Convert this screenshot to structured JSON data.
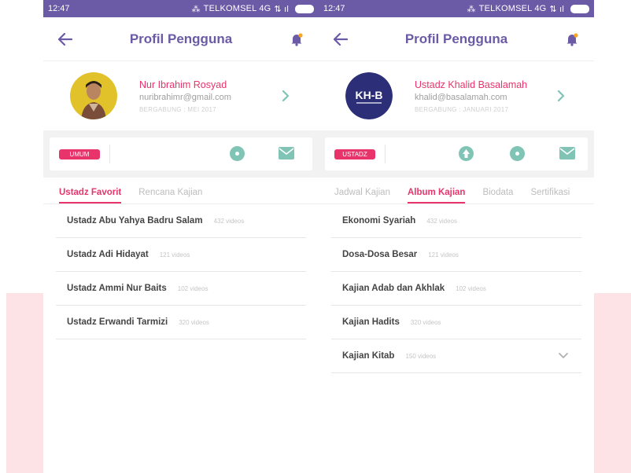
{
  "colors": {
    "primary": "#6b5aa6",
    "accent": "#e8346a",
    "teal": "#7fc4b5",
    "pink_bg": "#fde3e6"
  },
  "left": {
    "status": {
      "time": "12:47",
      "carrier": "TELKOMSEL 4G"
    },
    "header": {
      "title": "Profil Pengguna"
    },
    "profile": {
      "name": "Nur Ibrahim Rosyad",
      "email": "nuribrahimr@gmail.com",
      "joined": "BERGABUNG : MEI 2017"
    },
    "badge": "UMUM",
    "tabs": [
      {
        "label": "Ustadz Favorit",
        "active": true
      },
      {
        "label": "Rencana Kajian",
        "active": false
      }
    ],
    "items": [
      {
        "name": "Ustadz Abu Yahya Badru Salam",
        "count": "432 videos"
      },
      {
        "name": "Ustadz Adi Hidayat",
        "count": "121 videos"
      },
      {
        "name": "Ustadz Ammi Nur Baits",
        "count": "102 videos"
      },
      {
        "name": "Ustadz Erwandi Tarmizi",
        "count": "320 videos"
      }
    ]
  },
  "right": {
    "status": {
      "time": "12:47",
      "carrier": "TELKOMSEL 4G"
    },
    "header": {
      "title": "Profil Pengguna"
    },
    "profile": {
      "name": "Ustadz Khalid Basalamah",
      "email": "khalid@basalamah.com",
      "joined": "BERGABUNG : JANUARI 2017",
      "logo_text": "KH-B"
    },
    "badge": "USTADZ",
    "tabs": [
      {
        "label": "Jadwal Kajian",
        "active": false
      },
      {
        "label": "Album Kajian",
        "active": true
      },
      {
        "label": "Biodata",
        "active": false
      },
      {
        "label": "Sertifikasi",
        "active": false
      }
    ],
    "items": [
      {
        "name": "Ekonomi Syariah",
        "count": "432 videos"
      },
      {
        "name": "Dosa-Dosa Besar",
        "count": "121 videos"
      },
      {
        "name": "Kajian Adab dan Akhlak",
        "count": "102 videos"
      },
      {
        "name": "Kajian Hadits",
        "count": "320 videos"
      },
      {
        "name": "Kajian Kitab",
        "count": "150 videos"
      }
    ]
  }
}
